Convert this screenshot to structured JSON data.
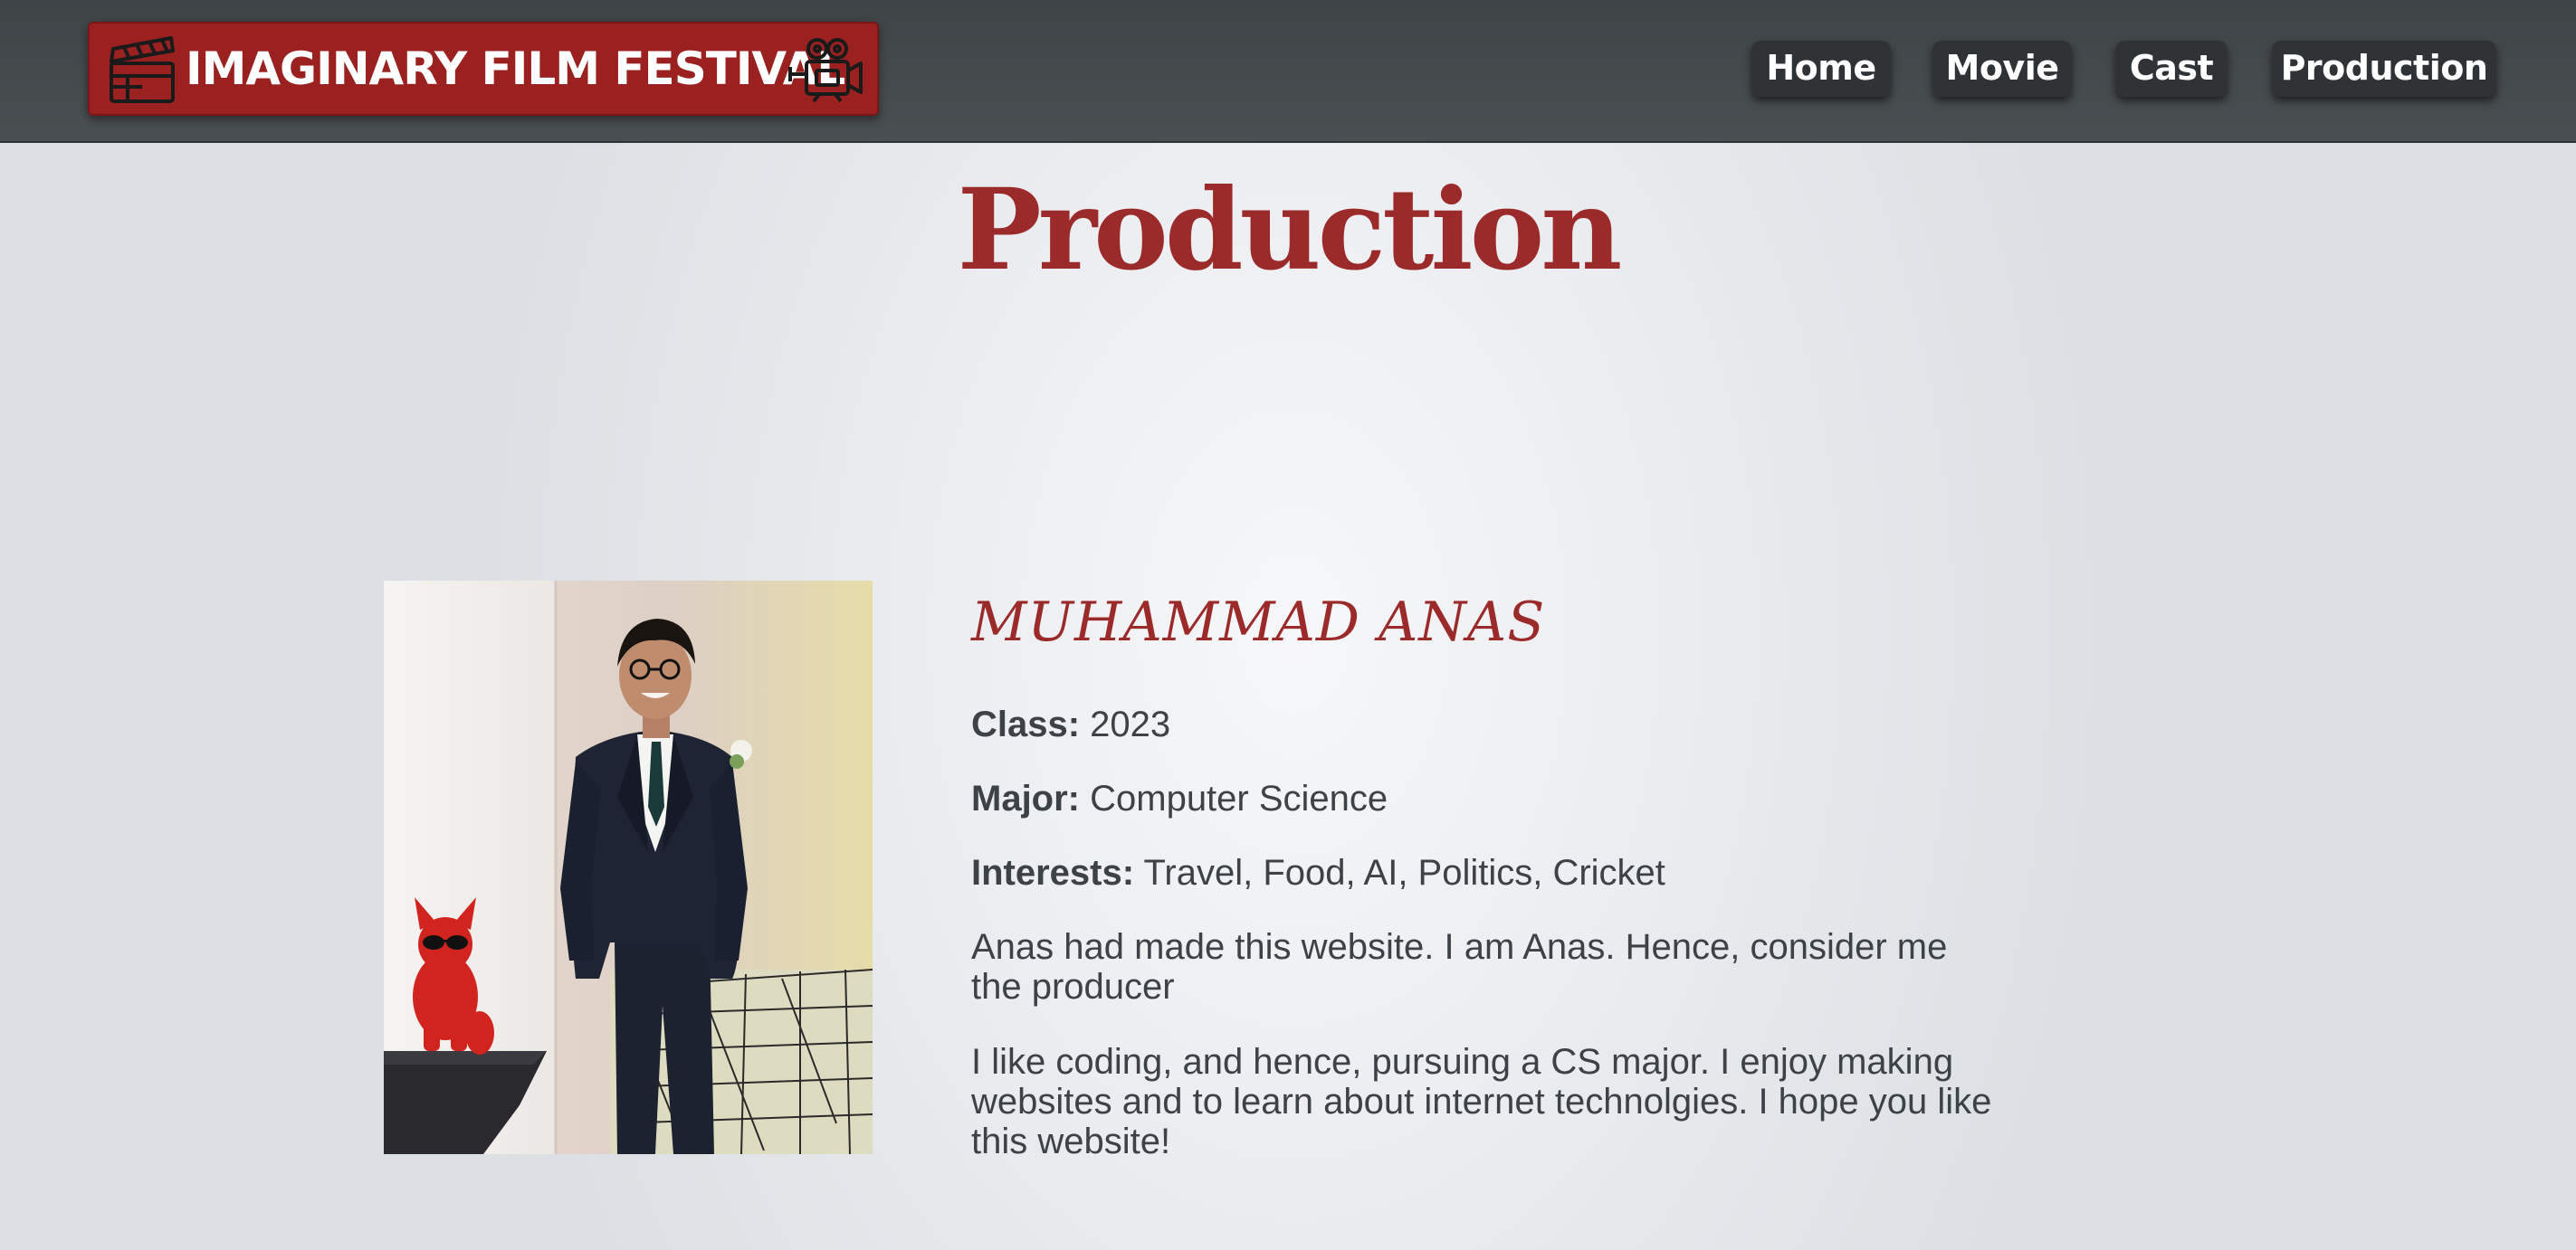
{
  "header": {
    "logo_text": "IMAGINARY FILM FESTIVAL",
    "logo_icons": [
      "clapperboard-icon",
      "movie-camera-icon"
    ],
    "nav": [
      {
        "label": "Home"
      },
      {
        "label": "Movie"
      },
      {
        "label": "Cast"
      },
      {
        "label": "Production"
      }
    ]
  },
  "main": {
    "title": "Production",
    "person": {
      "name": "MUHAMMAD ANAS",
      "class_label": "Class:",
      "class_value": " 2023",
      "major_label": "Major:",
      "major_value": " Computer Science",
      "interests_label": "Interests:",
      "interests_value": " Travel, Food, AI, Politics, Cricket",
      "paragraph_1": "Anas had made this website. I am Anas. Hence, consider me the producer",
      "paragraph_2": "I like coding, and hence, pursuing a CS major. I enjoy making websites and to learn about internet technolgies. I hope you like this website!"
    }
  },
  "colors": {
    "header_bg": "#43484b",
    "logo_bg": "#9b2121",
    "nav_button_bg": "#2f3336",
    "accent_red": "#9b2a2a",
    "body_text": "#3d4247"
  }
}
